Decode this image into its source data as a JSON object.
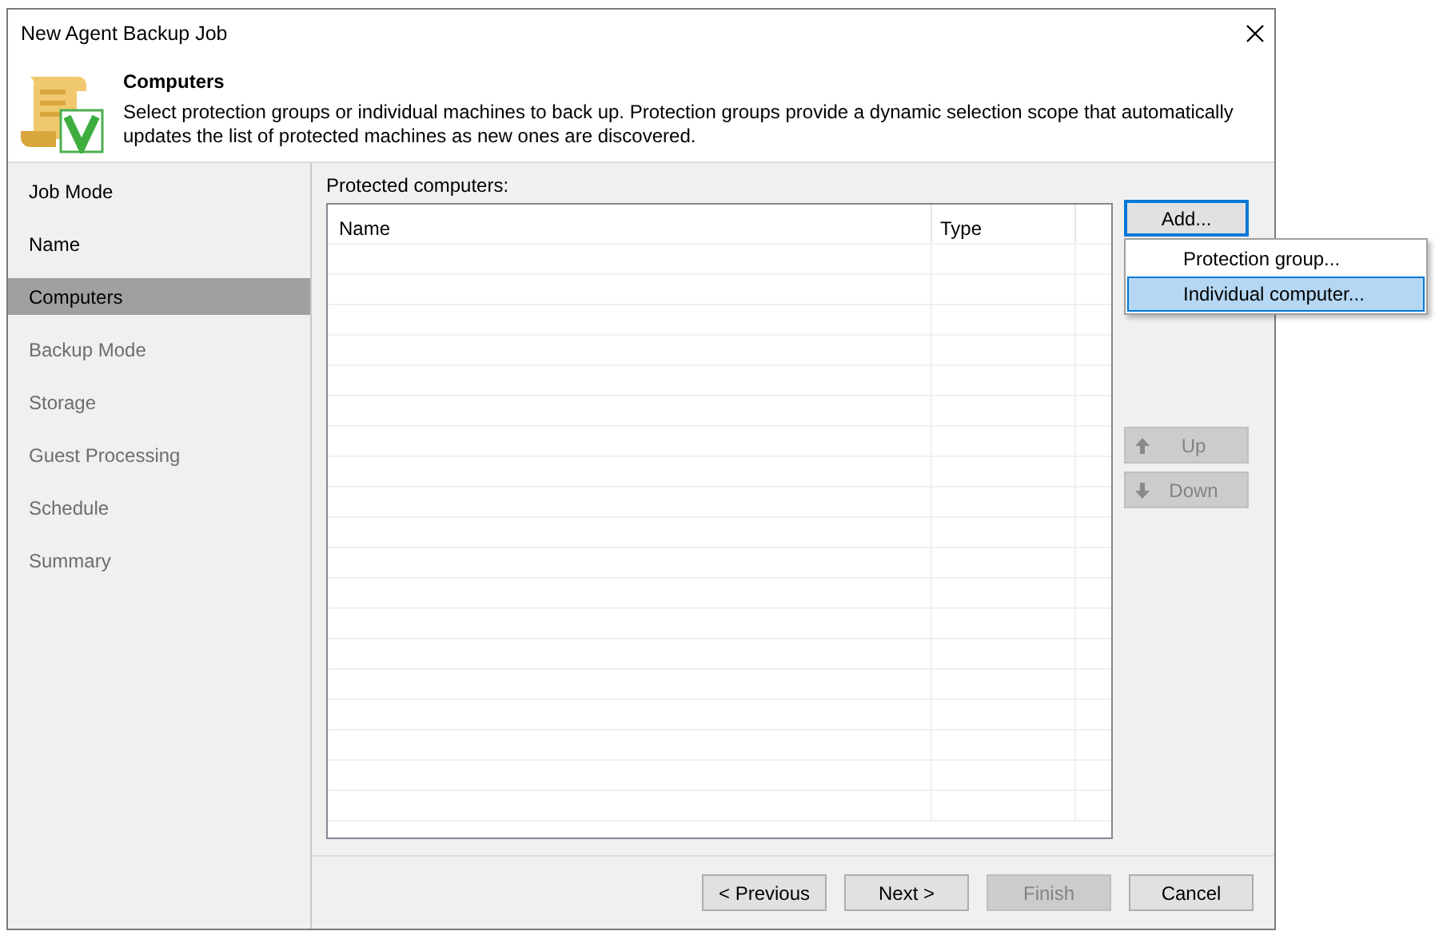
{
  "window": {
    "title": "New Agent Backup Job"
  },
  "header": {
    "title": "Computers",
    "description": "Select protection groups or individual machines to back up. Protection groups provide a dynamic selection scope that automatically updates the list of protected machines as new ones are discovered."
  },
  "steps": [
    {
      "label": "Job Mode",
      "selected": false,
      "disabled": false
    },
    {
      "label": "Name",
      "selected": false,
      "disabled": false
    },
    {
      "label": "Computers",
      "selected": true,
      "disabled": false
    },
    {
      "label": "Backup Mode",
      "selected": false,
      "disabled": true
    },
    {
      "label": "Storage",
      "selected": false,
      "disabled": true
    },
    {
      "label": "Guest Processing",
      "selected": false,
      "disabled": true
    },
    {
      "label": "Schedule",
      "selected": false,
      "disabled": true
    },
    {
      "label": "Summary",
      "selected": false,
      "disabled": true
    }
  ],
  "table": {
    "label": "Protected computers:",
    "columns": [
      "Name",
      "Type"
    ]
  },
  "side_buttons": [
    {
      "label": "Add...",
      "disabled": false,
      "focused": true,
      "kind": "plain"
    },
    {
      "label": "Up",
      "disabled": true,
      "focused": false,
      "kind": "up"
    },
    {
      "label": "Down",
      "disabled": true,
      "focused": false,
      "kind": "down"
    }
  ],
  "add_menu": [
    {
      "label": "Protection group...",
      "selected": false
    },
    {
      "label": "Individual computer...",
      "selected": true
    }
  ],
  "footer_buttons": [
    {
      "label": "< Previous",
      "disabled": false
    },
    {
      "label": "Next >",
      "disabled": false
    },
    {
      "label": "Finish",
      "disabled": true
    },
    {
      "label": "Cancel",
      "disabled": false
    }
  ]
}
